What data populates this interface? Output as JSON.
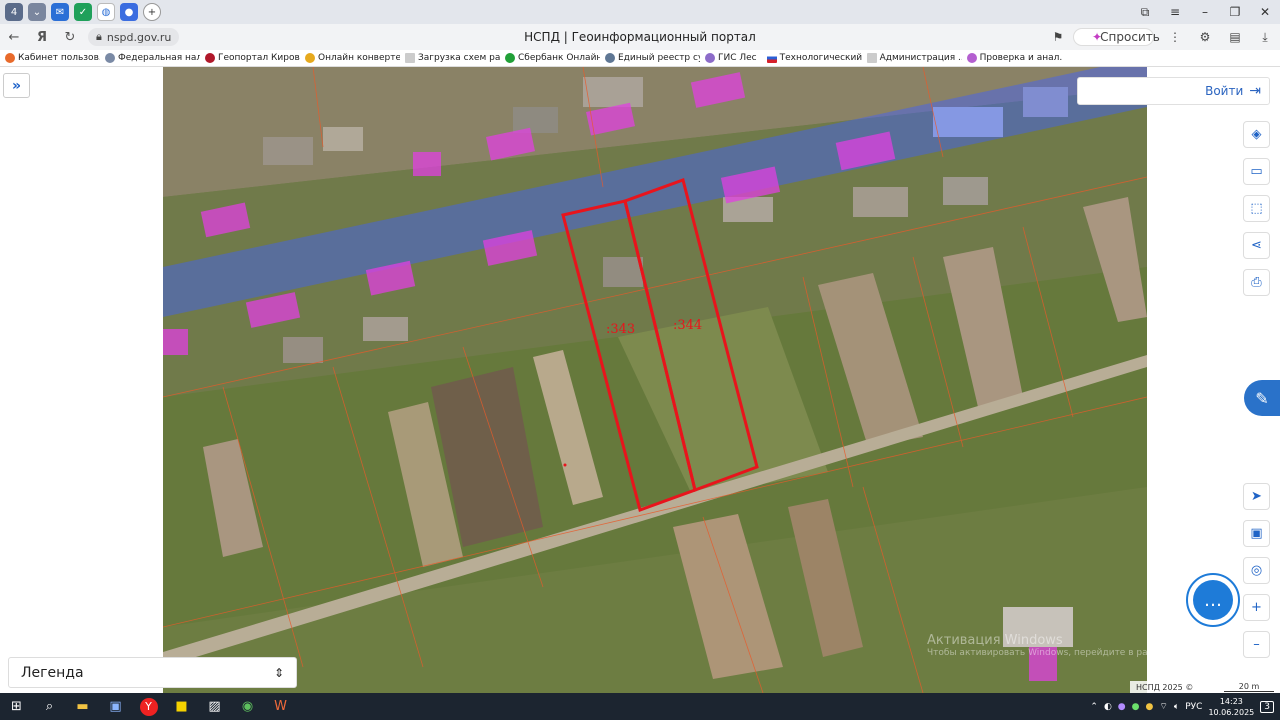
{
  "browser": {
    "url": "nspd.gov.ru",
    "page_title": "НСПД | Геоинформационный портал",
    "ask_label": "Спросить",
    "bookmarks": [
      "Кабинет пользов...",
      "Федеральная нал...",
      "Геопортал Киров...",
      "Онлайн конверте...",
      "Загрузка схем ра...",
      "Сбербанк Онлайн",
      "Единый реестр су...",
      "ГИС Лес",
      "Технологический...",
      "Администрация ...",
      "Проверка и анал..."
    ]
  },
  "map": {
    "parcel_labels": [
      ":343",
      ":344"
    ],
    "attribution": "НСПД 2025 ©",
    "scale": "20 m",
    "watermark_title": "Активация Windows",
    "watermark_text": "Чтобы активировать Windows, перейдите в раздел \"Параметры\"."
  },
  "panel": {
    "login_label": "Войти",
    "legend_label": "Легенда"
  },
  "taskbar": {
    "lang": "РУС",
    "time": "14:23",
    "date": "10.06.2025",
    "notifications": "3"
  },
  "colors": {
    "accent": "#1f63c6",
    "parcel_outline": "#e8141c",
    "road_zone": "#3f5fff",
    "building_zone": "#e040e0"
  }
}
